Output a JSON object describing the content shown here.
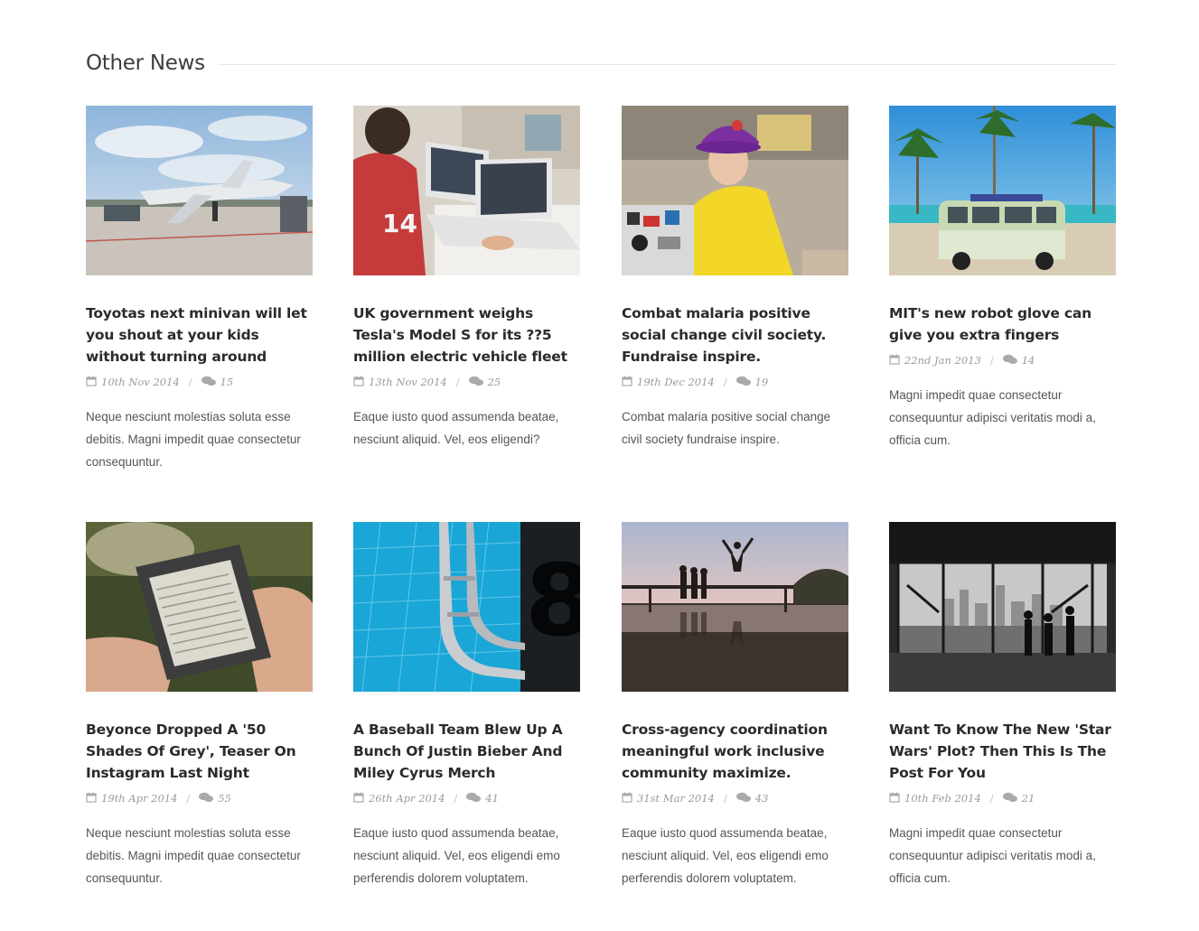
{
  "section": {
    "title": "Other News"
  },
  "articles": [
    {
      "title": "Toyotas next minivan will let you shout at your kids without turning around",
      "date": "10th Nov 2014",
      "comments": "15",
      "excerpt": "Neque nesciunt molestias soluta esse debitis. Magni impedit quae consectetur consequuntur.",
      "image": "airplane-photo"
    },
    {
      "title": "UK government weighs Tesla's Model S for its ??5 million electric vehicle fleet",
      "date": "13th Nov 2014",
      "comments": "25",
      "excerpt": "Eaque iusto quod assumenda beatae, nesciunt aliquid. Vel, eos eligendi?",
      "image": "laptop-kid-photo"
    },
    {
      "title": "Combat malaria positive social change civil society. Fundraise inspire.",
      "date": "19th Dec 2014",
      "comments": "19",
      "excerpt": "Combat malaria positive social change civil society fundraise inspire.",
      "image": "hat-man-photo"
    },
    {
      "title": "MIT's new robot glove can give you extra fingers",
      "date": "22nd Jan 2013",
      "comments": "14",
      "excerpt": "Magni impedit quae consectetur consequuntur adipisci veritatis modi a, officia cum.",
      "image": "beach-van-photo"
    },
    {
      "title": "Beyonce Dropped A '50 Shades Of Grey', Teaser On Instagram Last Night",
      "date": "19th Apr 2014",
      "comments": "55",
      "excerpt": "Neque nesciunt molestias soluta esse debitis. Magni impedit quae consectetur consequuntur.",
      "image": "ereader-photo"
    },
    {
      "title": "A Baseball Team Blew Up A Bunch Of Justin Bieber And Miley Cyrus Merch",
      "date": "26th Apr 2014",
      "comments": "41",
      "excerpt": "Eaque iusto quod assumenda beatae, nesciunt aliquid. Vel, eos eligendi emo perferendis dolorem voluptatem.",
      "image": "pool-ladder-photo"
    },
    {
      "title": "Cross-agency coordination meaningful work inclusive community maximize.",
      "date": "31st Mar 2014",
      "comments": "43",
      "excerpt": "Eaque iusto quod assumenda beatae, nesciunt aliquid. Vel, eos eligendi emo perferendis dolorem voluptatem.",
      "image": "jumping-silhouette-photo"
    },
    {
      "title": "Want To Know The New 'Star Wars' Plot? Then This Is The Post For You",
      "date": "10th Feb 2014",
      "comments": "21",
      "excerpt": "Magni impedit quae consectetur consequuntur adipisci veritatis modi a, officia cum.",
      "image": "city-window-photo"
    }
  ],
  "icons": {
    "date": "calendar-icon",
    "comments": "comments-icon"
  },
  "colors": {
    "title": "#2b2b2b",
    "meta": "#9a9a9a",
    "excerpt": "#555555",
    "rule": "#e6e6e6"
  }
}
